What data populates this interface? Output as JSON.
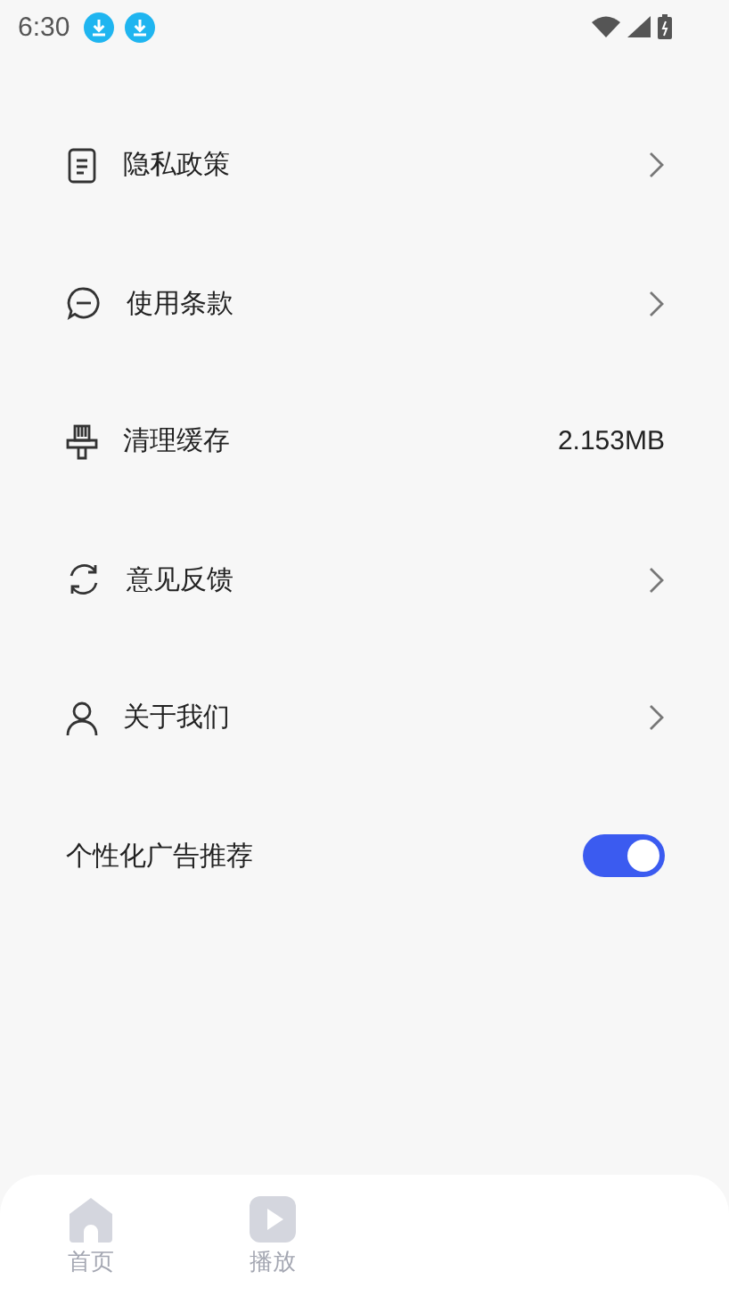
{
  "status_bar": {
    "time": "6:30",
    "notifications": [
      {
        "kind": "download"
      },
      {
        "kind": "download"
      }
    ]
  },
  "settings": [
    {
      "kind": "link",
      "label": "隐私政策"
    },
    {
      "kind": "link",
      "label": "使用条款"
    },
    {
      "kind": "value",
      "label": "清理缓存",
      "value": "2.153MB"
    },
    {
      "kind": "link",
      "label": "意见反馈"
    },
    {
      "kind": "link",
      "label": "关于我们"
    },
    {
      "kind": "toggle",
      "label": "个性化广告推荐",
      "on": true
    }
  ],
  "bottom_nav": [
    {
      "label": "首页",
      "selected": false
    },
    {
      "label": "播放",
      "selected": false
    }
  ]
}
